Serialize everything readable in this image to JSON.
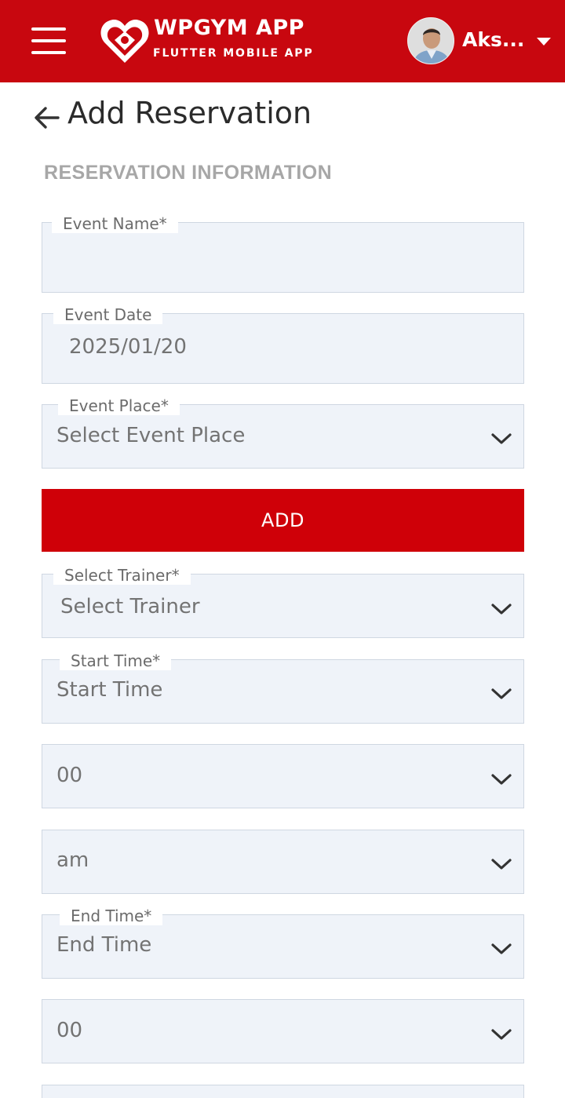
{
  "header": {
    "brand_title": "WPGYM APP",
    "brand_subtitle": "FLUTTER MOBILE APP",
    "user_name": "Aks...",
    "menu_icon": "hamburger-menu-icon",
    "logo_icon": "heart-logo-icon",
    "colors": {
      "header_bg": "#c8070f",
      "text": "#ffffff"
    }
  },
  "page": {
    "title": "Add Reservation",
    "back_icon": "arrow-left-icon",
    "section_title": "RESERVATION INFORMATION"
  },
  "form": {
    "event_name": {
      "label": "Event Name*",
      "value": ""
    },
    "event_date": {
      "label": "Event Date",
      "value": "2025/01/20"
    },
    "event_place": {
      "label": "Event Place*",
      "value": "Select Event Place"
    },
    "add_button": {
      "label": "ADD",
      "color": "#cf0008"
    },
    "trainer": {
      "label": "Select Trainer*",
      "value": "Select Trainer"
    },
    "start_time": {
      "label": "Start Time*",
      "value": "Start Time"
    },
    "start_minute": {
      "value": "00"
    },
    "start_ampm": {
      "value": "am"
    },
    "end_time": {
      "label": "End Time*",
      "value": "End Time"
    },
    "end_minute": {
      "value": "00"
    }
  },
  "colors": {
    "field_bg": "#eff3f9",
    "field_border": "#cfd7e2",
    "muted_text": "#737373"
  }
}
